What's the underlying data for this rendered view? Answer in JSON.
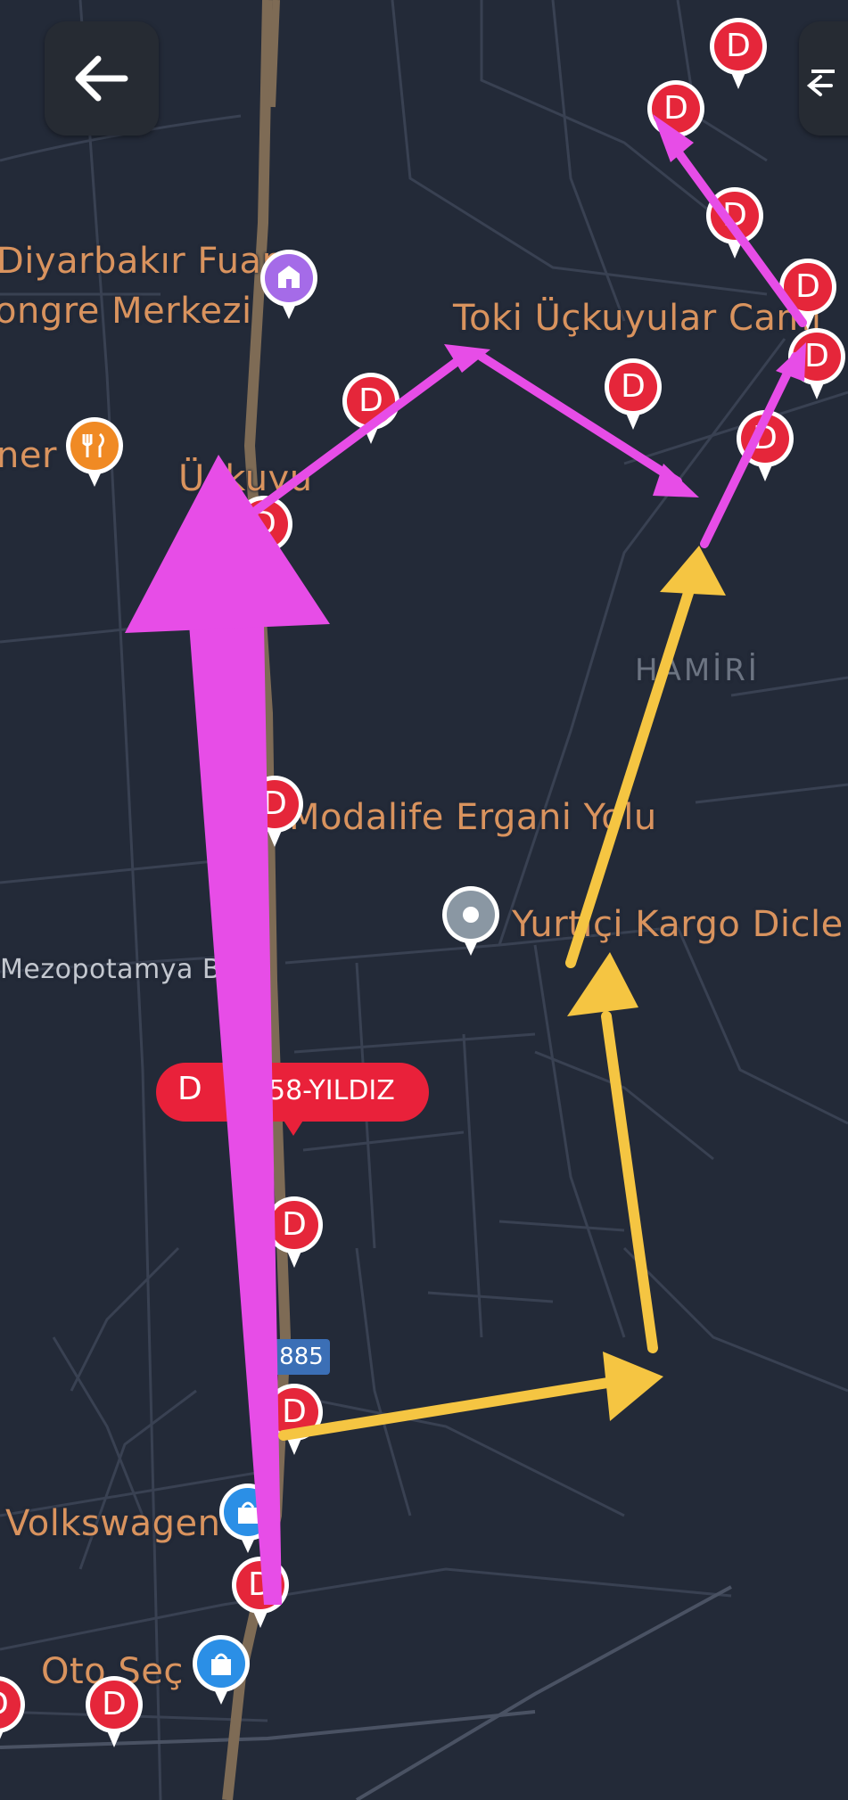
{
  "map": {
    "labels": {
      "fuar": "Diyarbakır Fuar",
      "kongre": "ongre Merkezi",
      "toki": "Toki Üçkuyular Cami",
      "uckuyu": "Üçkuyu",
      "mer": "ner",
      "hamiri": "HAMİRİ",
      "modalife": "Modalife Ergani Yolu",
      "yurtici": "Yurtiçi Kargo Dicle",
      "mezopotamya": "Mezopotamya Bl",
      "volkswagen": "Volkswagen",
      "otocec": "Oto Seç"
    },
    "selected_station": {
      "icon_letter": "D",
      "name": "58-YILDIZ"
    },
    "road_shield": "885",
    "station_letter": "D",
    "colors": {
      "background": "#232a38",
      "road": "#3a4252",
      "highway": "#7e6b55",
      "station_pin": "#e5263a",
      "label": "#d9935e",
      "annotation_magenta": "#e74de7",
      "annotation_yellow": "#f5c542"
    }
  },
  "controls": {
    "back_icon": "arrow-left-icon",
    "right_icon": "arrow-left-icon"
  }
}
